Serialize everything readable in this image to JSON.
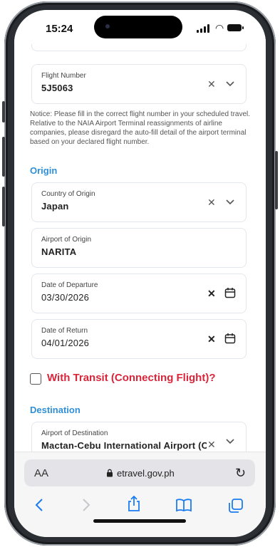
{
  "status": {
    "time": "15:24"
  },
  "flight_number": {
    "label": "Flight Number",
    "value": "5J5063"
  },
  "notice": "Notice: Please fill in the correct flight number in your scheduled travel. Relative to the NAIA Airport Terminal reassignments of airline companies, please disregard the auto-fill detail of the airport terminal based on your declared flight number.",
  "origin": {
    "heading": "Origin",
    "country_label": "Country of Origin",
    "country_value": "Japan",
    "airport_label": "Airport of Origin",
    "airport_value": "NARITA",
    "departure_label": "Date of Departure",
    "departure_value": "03/30/2026",
    "return_label": "Date of Return",
    "return_value": "04/01/2026"
  },
  "transit": {
    "label": "With Transit (Connecting Flight)?"
  },
  "destination": {
    "heading": "Destination",
    "airport_label": "Airport of Destination",
    "airport_value": "Mactan-Cebu International Airport (CEB)"
  },
  "browser": {
    "aa": "AA",
    "url": "etravel.gov.ph"
  },
  "colors": {
    "accent": "#2f8fd8",
    "transit_red": "#d9253a",
    "ios_blue": "#1a7cf0"
  },
  "icons": [
    "clear-x-icon",
    "chevron-down-icon",
    "calendar-icon",
    "lock-icon",
    "reload-icon",
    "back-icon",
    "forward-icon",
    "share-icon",
    "bookmarks-icon",
    "tabs-icon"
  ]
}
